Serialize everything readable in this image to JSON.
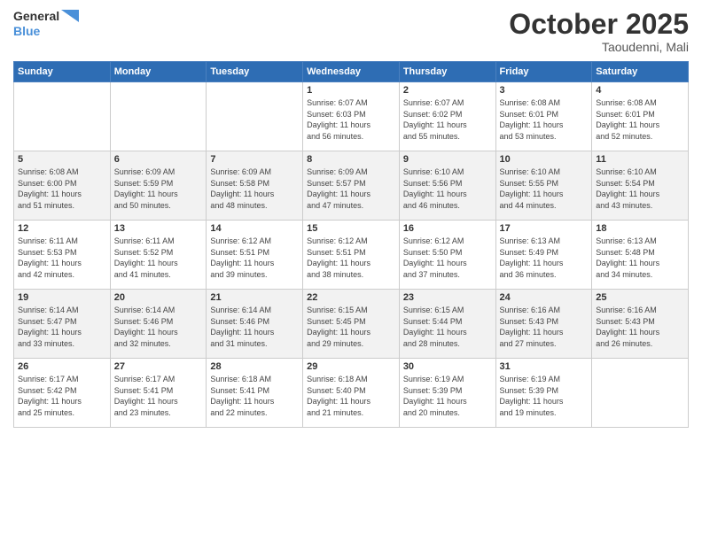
{
  "logo": {
    "line1": "General",
    "line2": "Blue"
  },
  "title": "October 2025",
  "subtitle": "Taoudenni, Mali",
  "days_header": [
    "Sunday",
    "Monday",
    "Tuesday",
    "Wednesday",
    "Thursday",
    "Friday",
    "Saturday"
  ],
  "weeks": [
    [
      {
        "day": "",
        "info": ""
      },
      {
        "day": "",
        "info": ""
      },
      {
        "day": "",
        "info": ""
      },
      {
        "day": "1",
        "info": "Sunrise: 6:07 AM\nSunset: 6:03 PM\nDaylight: 11 hours\nand 56 minutes."
      },
      {
        "day": "2",
        "info": "Sunrise: 6:07 AM\nSunset: 6:02 PM\nDaylight: 11 hours\nand 55 minutes."
      },
      {
        "day": "3",
        "info": "Sunrise: 6:08 AM\nSunset: 6:01 PM\nDaylight: 11 hours\nand 53 minutes."
      },
      {
        "day": "4",
        "info": "Sunrise: 6:08 AM\nSunset: 6:01 PM\nDaylight: 11 hours\nand 52 minutes."
      }
    ],
    [
      {
        "day": "5",
        "info": "Sunrise: 6:08 AM\nSunset: 6:00 PM\nDaylight: 11 hours\nand 51 minutes."
      },
      {
        "day": "6",
        "info": "Sunrise: 6:09 AM\nSunset: 5:59 PM\nDaylight: 11 hours\nand 50 minutes."
      },
      {
        "day": "7",
        "info": "Sunrise: 6:09 AM\nSunset: 5:58 PM\nDaylight: 11 hours\nand 48 minutes."
      },
      {
        "day": "8",
        "info": "Sunrise: 6:09 AM\nSunset: 5:57 PM\nDaylight: 11 hours\nand 47 minutes."
      },
      {
        "day": "9",
        "info": "Sunrise: 6:10 AM\nSunset: 5:56 PM\nDaylight: 11 hours\nand 46 minutes."
      },
      {
        "day": "10",
        "info": "Sunrise: 6:10 AM\nSunset: 5:55 PM\nDaylight: 11 hours\nand 44 minutes."
      },
      {
        "day": "11",
        "info": "Sunrise: 6:10 AM\nSunset: 5:54 PM\nDaylight: 11 hours\nand 43 minutes."
      }
    ],
    [
      {
        "day": "12",
        "info": "Sunrise: 6:11 AM\nSunset: 5:53 PM\nDaylight: 11 hours\nand 42 minutes."
      },
      {
        "day": "13",
        "info": "Sunrise: 6:11 AM\nSunset: 5:52 PM\nDaylight: 11 hours\nand 41 minutes."
      },
      {
        "day": "14",
        "info": "Sunrise: 6:12 AM\nSunset: 5:51 PM\nDaylight: 11 hours\nand 39 minutes."
      },
      {
        "day": "15",
        "info": "Sunrise: 6:12 AM\nSunset: 5:51 PM\nDaylight: 11 hours\nand 38 minutes."
      },
      {
        "day": "16",
        "info": "Sunrise: 6:12 AM\nSunset: 5:50 PM\nDaylight: 11 hours\nand 37 minutes."
      },
      {
        "day": "17",
        "info": "Sunrise: 6:13 AM\nSunset: 5:49 PM\nDaylight: 11 hours\nand 36 minutes."
      },
      {
        "day": "18",
        "info": "Sunrise: 6:13 AM\nSunset: 5:48 PM\nDaylight: 11 hours\nand 34 minutes."
      }
    ],
    [
      {
        "day": "19",
        "info": "Sunrise: 6:14 AM\nSunset: 5:47 PM\nDaylight: 11 hours\nand 33 minutes."
      },
      {
        "day": "20",
        "info": "Sunrise: 6:14 AM\nSunset: 5:46 PM\nDaylight: 11 hours\nand 32 minutes."
      },
      {
        "day": "21",
        "info": "Sunrise: 6:14 AM\nSunset: 5:46 PM\nDaylight: 11 hours\nand 31 minutes."
      },
      {
        "day": "22",
        "info": "Sunrise: 6:15 AM\nSunset: 5:45 PM\nDaylight: 11 hours\nand 29 minutes."
      },
      {
        "day": "23",
        "info": "Sunrise: 6:15 AM\nSunset: 5:44 PM\nDaylight: 11 hours\nand 28 minutes."
      },
      {
        "day": "24",
        "info": "Sunrise: 6:16 AM\nSunset: 5:43 PM\nDaylight: 11 hours\nand 27 minutes."
      },
      {
        "day": "25",
        "info": "Sunrise: 6:16 AM\nSunset: 5:43 PM\nDaylight: 11 hours\nand 26 minutes."
      }
    ],
    [
      {
        "day": "26",
        "info": "Sunrise: 6:17 AM\nSunset: 5:42 PM\nDaylight: 11 hours\nand 25 minutes."
      },
      {
        "day": "27",
        "info": "Sunrise: 6:17 AM\nSunset: 5:41 PM\nDaylight: 11 hours\nand 23 minutes."
      },
      {
        "day": "28",
        "info": "Sunrise: 6:18 AM\nSunset: 5:41 PM\nDaylight: 11 hours\nand 22 minutes."
      },
      {
        "day": "29",
        "info": "Sunrise: 6:18 AM\nSunset: 5:40 PM\nDaylight: 11 hours\nand 21 minutes."
      },
      {
        "day": "30",
        "info": "Sunrise: 6:19 AM\nSunset: 5:39 PM\nDaylight: 11 hours\nand 20 minutes."
      },
      {
        "day": "31",
        "info": "Sunrise: 6:19 AM\nSunset: 5:39 PM\nDaylight: 11 hours\nand 19 minutes."
      },
      {
        "day": "",
        "info": ""
      }
    ]
  ]
}
